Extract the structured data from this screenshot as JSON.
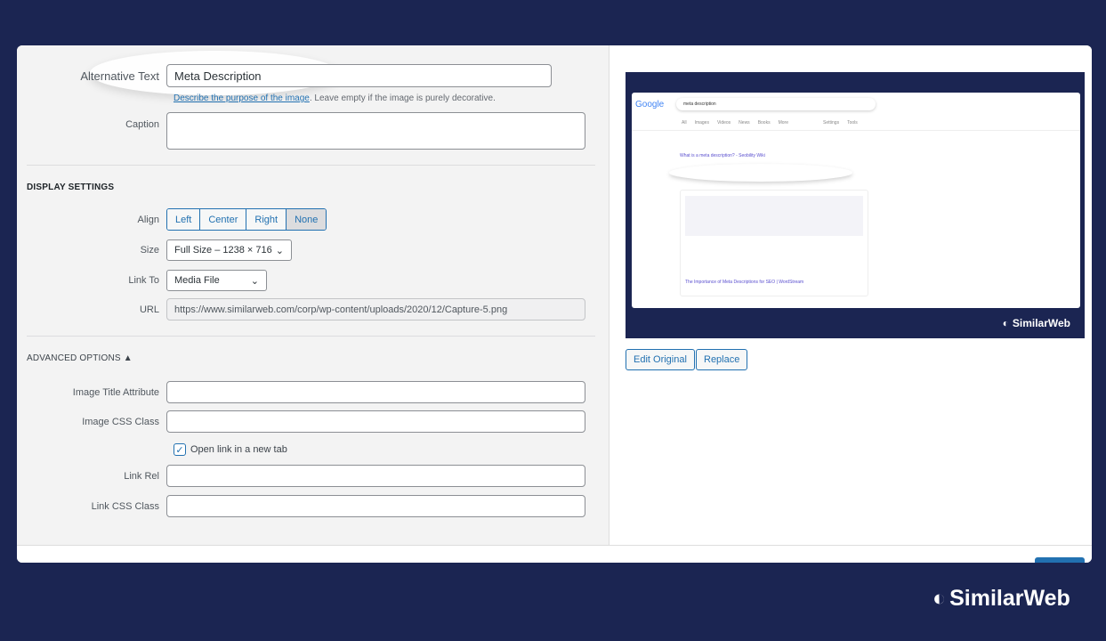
{
  "form": {
    "alt_label": "Alternative Text",
    "alt_value": "Meta Description",
    "alt_help_link": "Describe the purpose of the image",
    "alt_help_text": ". Leave empty if the image is purely decorative.",
    "caption_label": "Caption",
    "caption_value": "",
    "display_settings": "DISPLAY SETTINGS",
    "align_label": "Align",
    "align_options": [
      "Left",
      "Center",
      "Right",
      "None"
    ],
    "align_selected": "None",
    "size_label": "Size",
    "size_value": "Full Size – 1238 × 716",
    "linkto_label": "Link To",
    "linkto_value": "Media File",
    "url_label": "URL",
    "url_value": "https://www.similarweb.com/corp/wp-content/uploads/2020/12/Capture-5.png",
    "advanced": "ADVANCED OPTIONS",
    "title_attr_label": "Image Title Attribute",
    "css_class_label": "Image CSS Class",
    "new_tab_label": "Open link in a new tab",
    "new_tab_checked": true,
    "link_rel_label": "Link Rel",
    "link_css_label": "Link CSS Class"
  },
  "preview": {
    "google": "Google",
    "query": "meta description",
    "tabs": [
      "All",
      "Images",
      "Videos",
      "News",
      "Books",
      "More",
      "Settings",
      "Tools"
    ],
    "ad_title": "What is a meta description? - Seobility Wiki",
    "result_title": "The Importance of Meta Descriptions for SEO | WordStream",
    "watermark": "SimilarWeb"
  },
  "buttons": {
    "edit_original": "Edit Original",
    "replace": "Replace"
  },
  "brand": "SimilarWeb",
  "colors": {
    "background": "#1b2552",
    "accent": "#2271b1"
  }
}
